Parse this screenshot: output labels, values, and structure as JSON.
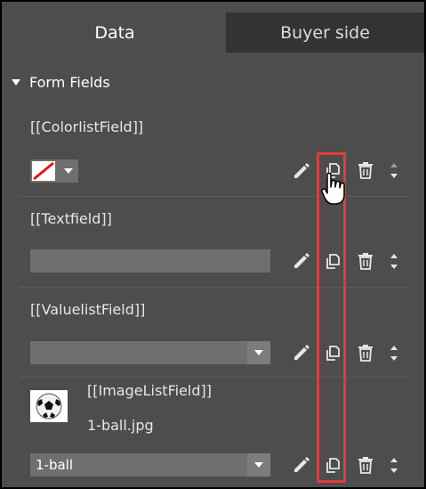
{
  "tabs": [
    {
      "label": "Data"
    },
    {
      "label": "Buyer side"
    }
  ],
  "section": {
    "title": "Form Fields"
  },
  "fields": [
    {
      "label": "[[ColorlistField]]"
    },
    {
      "label": "[[Textfield]]"
    },
    {
      "label": "[[ValuelistField]]"
    },
    {
      "label": "[[ImageListField]]",
      "filename": "1-ball.jpg",
      "selected": "1-ball"
    }
  ],
  "icons": [
    "pencil-icon",
    "copy-icon",
    "trash-icon",
    "sort-arrows-icon",
    "hand-cursor-icon",
    "soccer-ball-image"
  ],
  "colors": {
    "highlight": "#e23b3b",
    "panel": "#4d4d4d",
    "inactive_tab": "#333333"
  }
}
